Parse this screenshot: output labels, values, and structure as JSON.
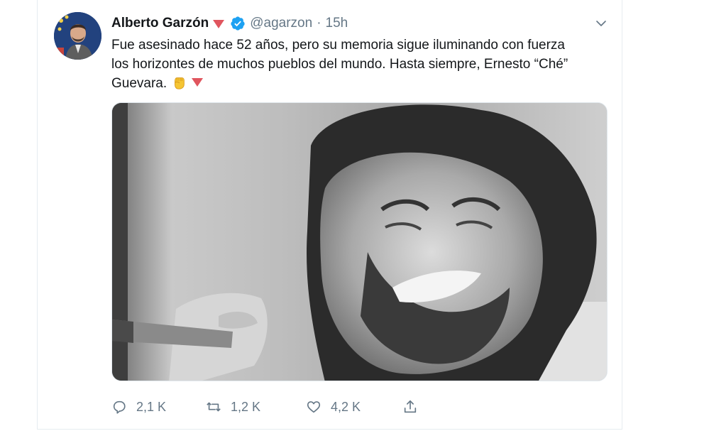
{
  "tweet": {
    "display_name": "Alberto Garzón",
    "handle": "@agarzon",
    "separator": "·",
    "time": "15h",
    "text_lines": [
      "Fue asesinado hace 52 años, pero su memoria sigue iluminando con fuerza",
      "los horizontes de muchos pueblos del mundo. Hasta siempre, Ernesto “Ché”",
      "Guevara."
    ],
    "icons": {
      "verified": "verified-badge-icon",
      "flag": "red-triangle-flag-icon",
      "fist": "raised-fist-icon",
      "caret": "chevron-down-icon"
    },
    "colors": {
      "verified": "#1da1f2",
      "flag": "#e0555e",
      "muted": "#657786",
      "text": "#14171a"
    }
  },
  "actions": {
    "reply_count": "2,1 K",
    "retweet_count": "1,2 K",
    "like_count": "4,2 K"
  }
}
